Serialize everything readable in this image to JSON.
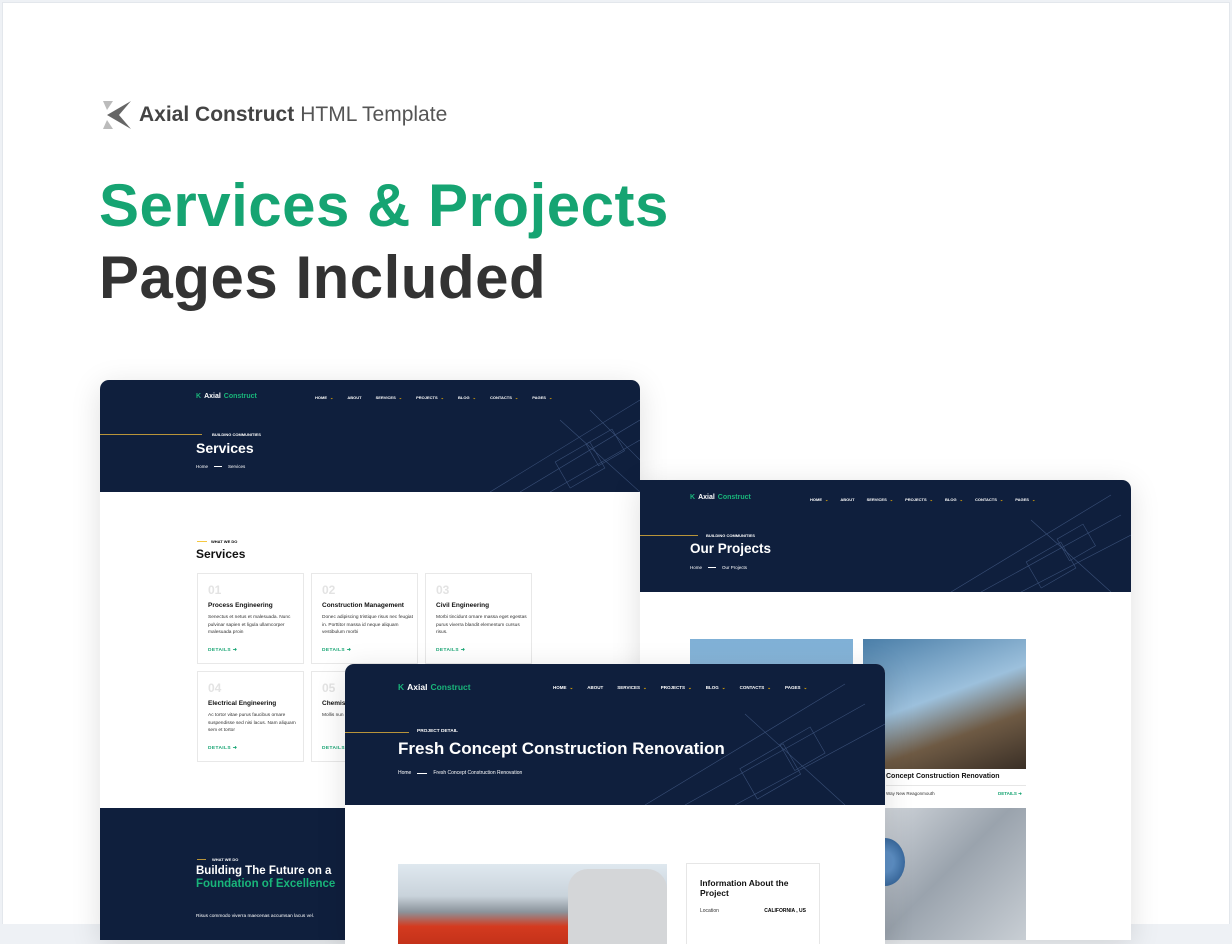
{
  "promo": {
    "brand_name": "Axial Construct",
    "brand_suffix": "HTML Template",
    "headline_green": "Services & Projects",
    "headline_dark": "Pages Included"
  },
  "colors": {
    "accent_green": "#16a472",
    "navy": "#0f1f3d",
    "gold": "#b8943a",
    "chevron_yellow": "#f5b400"
  },
  "site": {
    "logo_white": "Axial",
    "logo_green": "Construct",
    "nav": [
      {
        "label": "Home",
        "dropdown": true
      },
      {
        "label": "About",
        "dropdown": false
      },
      {
        "label": "Services",
        "dropdown": true
      },
      {
        "label": "Projects",
        "dropdown": true
      },
      {
        "label": "Blog",
        "dropdown": true
      },
      {
        "label": "Contacts",
        "dropdown": true
      },
      {
        "label": "Pages",
        "dropdown": true
      }
    ],
    "chevron": "⌄"
  },
  "services_page": {
    "kicker": "Building Communities",
    "title": "Services",
    "breadcrumb_home": "Home",
    "breadcrumb_current": "Services",
    "section_kicker": "What we do",
    "section_title": "Services",
    "cards": [
      {
        "num": "01",
        "title": "Process Engineering",
        "desc": "Senectus et netus et malesuada. Nunc pulvinar sapien et ligula ullamcorper malesuada proin",
        "link": "DETAILS ➜"
      },
      {
        "num": "02",
        "title": "Construction Management",
        "desc": "Donec adipiscing tristique risus nec feugiat in. Porttitor massa id neque aliquam vestibulum morbi",
        "link": "DETAILS ➜"
      },
      {
        "num": "03",
        "title": "Civil Engineering",
        "desc": "Morbi tincidunt ornare massa eget egestas purus viverra blandit elementum cursus risus.",
        "link": "DETAILS ➜"
      },
      {
        "num": "04",
        "title": "Electrical Engineering",
        "desc": "Ac tortor vitae purus faucibus ornare suspendisse sed nisi lacus. Nam aliquam sem et tortor",
        "link": "DETAILS ➜"
      },
      {
        "num": "05",
        "title": "Chemis",
        "desc": "Mollis nun etiam sit a morbi quis",
        "link": "DETAILS"
      }
    ],
    "bottom_kicker": "What we do",
    "bottom_title_white": "Building The Future on a",
    "bottom_title_green": "Foundation of Excellence",
    "bottom_text": "Risus commodo viverra maecenas accumsan lacus vel."
  },
  "projects_page": {
    "kicker": "Building Communities",
    "title": "Our Projects",
    "breadcrumb_home": "Home",
    "breadcrumb_current": "Our Projects",
    "project_caption": "Concept Construction Renovation",
    "project_address": "Way New Reagonmouth",
    "project_link": "DETAILS ➜"
  },
  "detail_page": {
    "kicker": "Project Detail",
    "title": "Fresh Concept Construction Renovation",
    "breadcrumb_home": "Home",
    "breadcrumb_current": "Fresh Concept Construction Renovation",
    "info_title": "Information About the Project",
    "info_rows": [
      {
        "label": "Location",
        "value": "CALIFORNIA , US"
      }
    ]
  }
}
